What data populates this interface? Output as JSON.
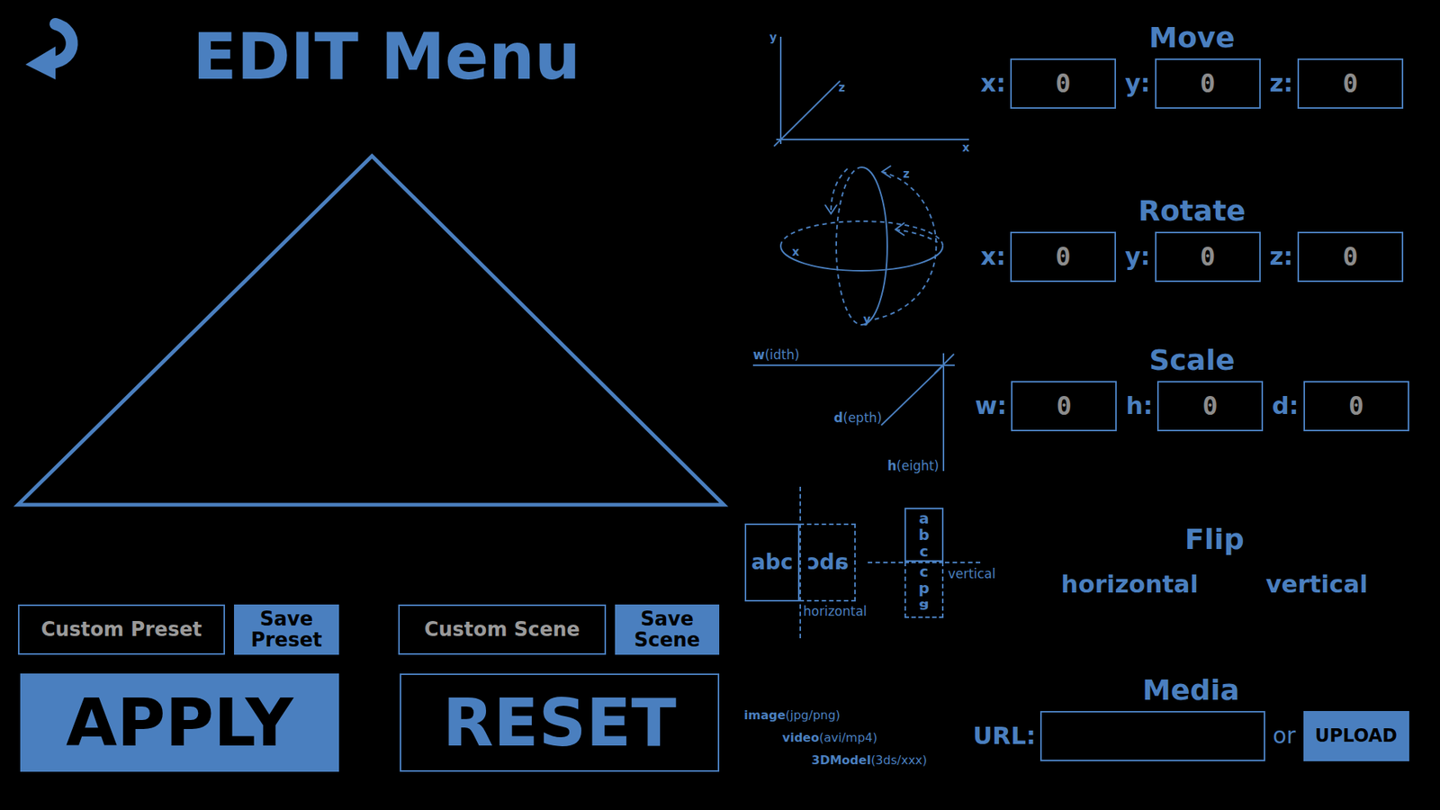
{
  "header": {
    "title": "EDIT Menu"
  },
  "preset": {
    "placeholder": "Custom Preset",
    "save": "Save Preset"
  },
  "scene": {
    "placeholder": "Custom Scene",
    "save": "Save Scene"
  },
  "actions": {
    "apply": "APPLY",
    "reset": "RESET"
  },
  "move": {
    "title": "Move",
    "diagram": {
      "y": "y",
      "z": "z",
      "x": "x"
    },
    "fields": [
      {
        "label": "x:",
        "value": "0"
      },
      {
        "label": "y:",
        "value": "0"
      },
      {
        "label": "z:",
        "value": "0"
      }
    ]
  },
  "rotate": {
    "title": "Rotate",
    "diagram": {
      "x": "x",
      "z": "z",
      "y": "y"
    },
    "fields": [
      {
        "label": "x:",
        "value": "0"
      },
      {
        "label": "y:",
        "value": "0"
      },
      {
        "label": "z:",
        "value": "0"
      }
    ]
  },
  "scale": {
    "title": "Scale",
    "diagram": {
      "width": {
        "key": "w",
        "rest": "(idth)"
      },
      "depth": {
        "key": "d",
        "rest": "(epth)"
      },
      "height": {
        "key": "h",
        "rest": "(eight)"
      }
    },
    "fields": [
      {
        "label": "w:",
        "value": "0"
      },
      {
        "label": "h:",
        "value": "0"
      },
      {
        "label": "d:",
        "value": "0"
      }
    ]
  },
  "flip": {
    "title": "Flip",
    "diagram": {
      "sample": "abc",
      "horizontal": "horizontal",
      "vertical": "vertical"
    },
    "options": [
      {
        "label": "horizontal",
        "selected": false
      },
      {
        "label": "vertical",
        "selected": false
      }
    ]
  },
  "media": {
    "title": "Media",
    "types": [
      {
        "name": "image",
        "formats": "(jpg/png)"
      },
      {
        "name": "video",
        "formats": "(avi/mp4)"
      },
      {
        "name": "3DModel",
        "formats": "(3ds/xxx)"
      }
    ],
    "urlLabel": "URL:",
    "url": "",
    "or": "or",
    "upload": "UPLOAD"
  }
}
